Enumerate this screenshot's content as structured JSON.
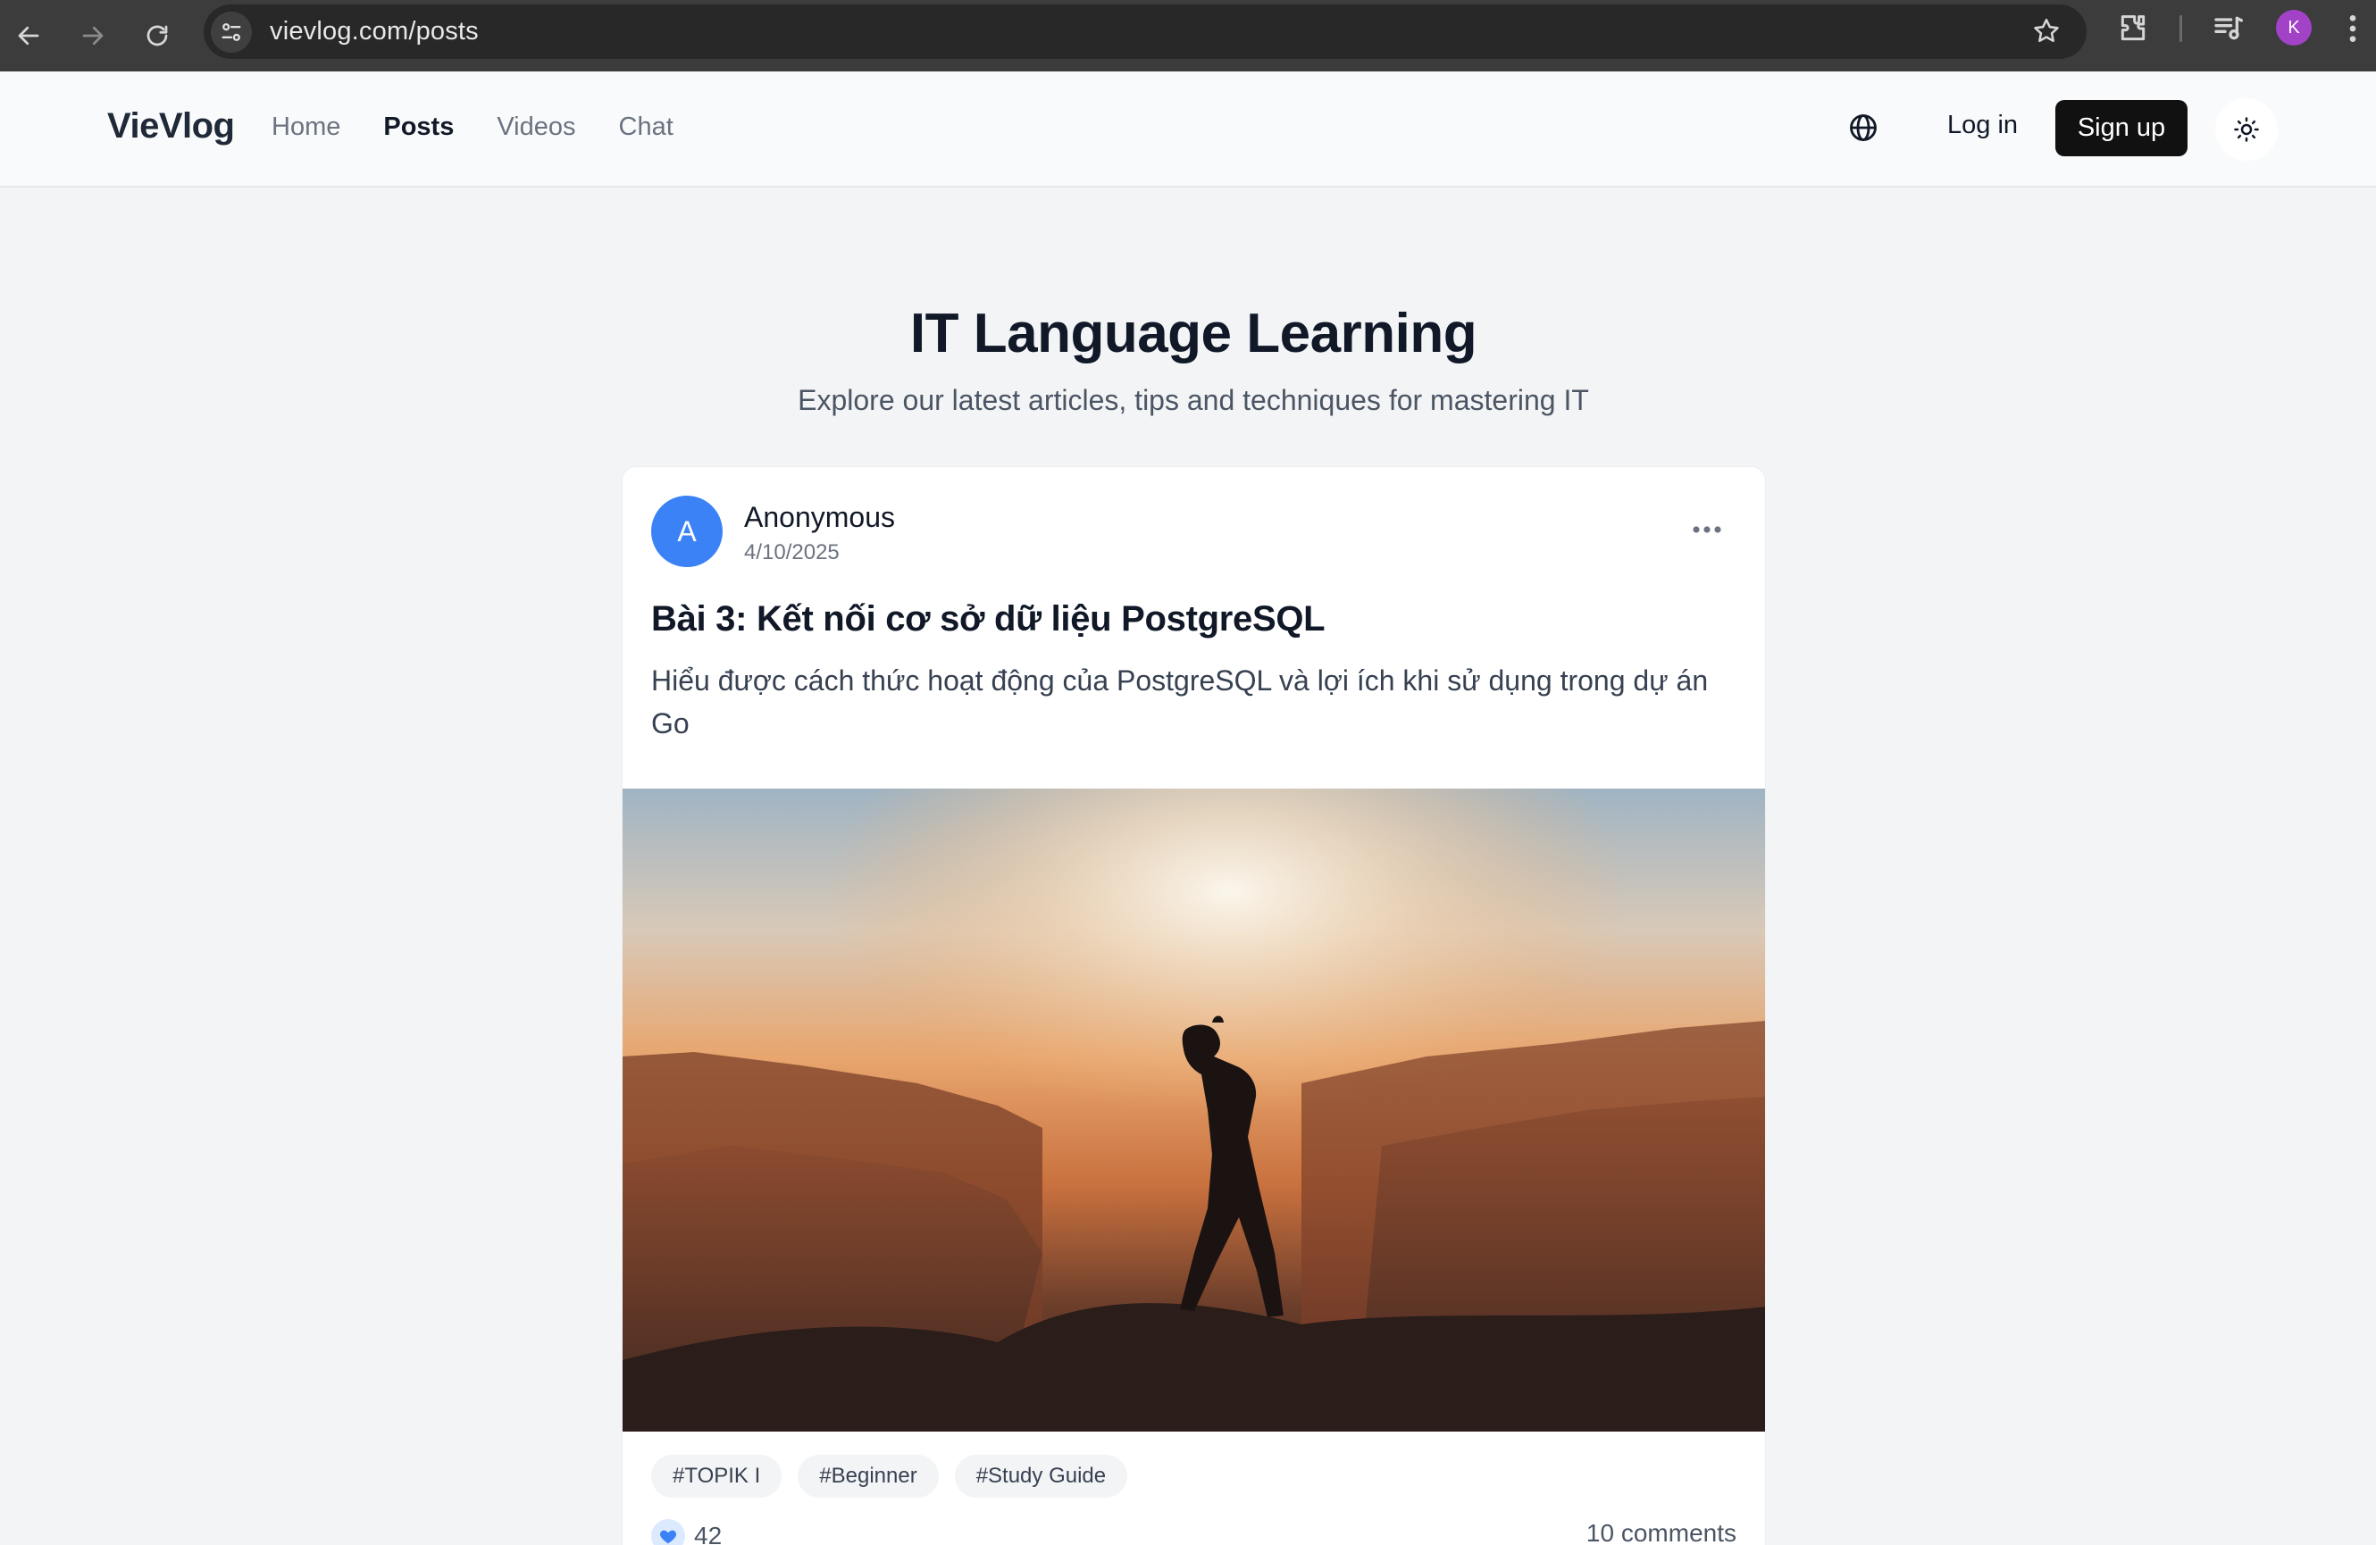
{
  "browser": {
    "url": "vievlog.com/posts",
    "profile_initial": "K"
  },
  "header": {
    "logo": "VieVlog",
    "nav": [
      "Home",
      "Posts",
      "Videos",
      "Chat"
    ],
    "active_nav": "Posts",
    "login": "Log in",
    "signup": "Sign up"
  },
  "hero": {
    "title": "IT Language Learning",
    "subtitle": "Explore our latest articles, tips and techniques for mastering IT"
  },
  "post": {
    "avatar_initial": "A",
    "author": "Anonymous",
    "date": "4/10/2025",
    "title": "Bài 3: Kết nối cơ sở dữ liệu PostgreSQL",
    "excerpt": "Hiểu được cách thức hoạt động của PostgreSQL và lợi ích khi sử dụng trong dự án Go",
    "image_desc": "silhouette of a person walking on a mountain ridge at sunset",
    "tags": [
      "#TOPIK I",
      "#Beginner",
      "#Study Guide"
    ],
    "likes": "42",
    "comments": "10 comments"
  },
  "colors": {
    "accent": "#3b82f6",
    "profile": "#a142c7",
    "signup_bg": "#111111"
  }
}
